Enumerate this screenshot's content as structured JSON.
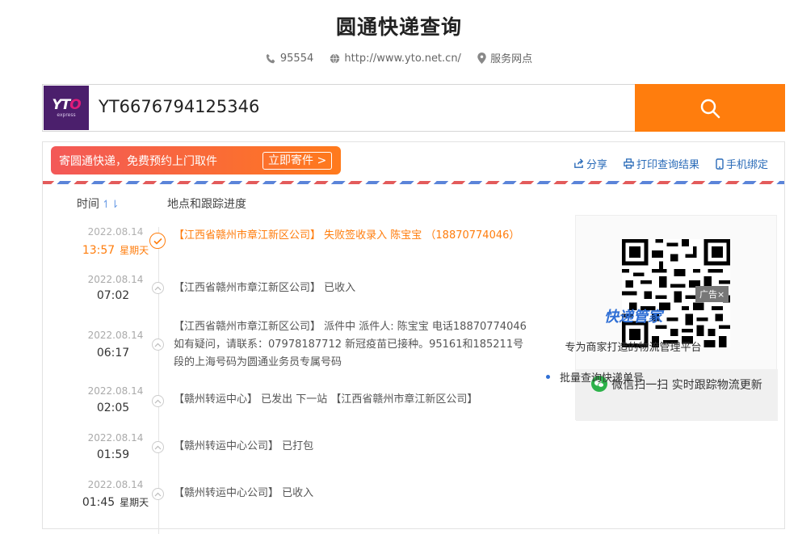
{
  "page": {
    "title": "圆通快递查询"
  },
  "info": {
    "phone": "95554",
    "website": "http://www.yto.net.cn/",
    "outlets": "服务网点"
  },
  "search": {
    "logo_text": "YTO",
    "logo_sub": "express",
    "tracking_number": "YT6676794125346",
    "icon": "search-icon"
  },
  "promo": {
    "text": "寄圆通快递，免费预约上门取件",
    "button": "立即寄件 >"
  },
  "actions": {
    "share": "分享",
    "print": "打印查询结果",
    "bind_phone": "手机绑定"
  },
  "columns": {
    "time": "时间",
    "sort_icon": "↿⇂",
    "location": "地点和跟踪进度"
  },
  "events": [
    {
      "date": "2022.08.14",
      "time": "13:57",
      "weekday": "星期天",
      "text": "【江西省赣州市章江新区公司】 失败签收录入 陈宝宝 （18870774046）"
    },
    {
      "date": "2022.08.14",
      "time": "07:02",
      "weekday": "",
      "text": "【江西省赣州市章江新区公司】 已收入"
    },
    {
      "date": "2022.08.14",
      "time": "06:17",
      "weekday": "",
      "text": "【江西省赣州市章江新区公司】 派件中 派件人: 陈宝宝 电话18870774046 如有疑问，请联系：07978187712 新冠疫苗已接种。95161和185211号段的上海号码为圆通业务员专属号码"
    },
    {
      "date": "2022.08.14",
      "time": "02:05",
      "weekday": "",
      "text": "【赣州转运中心】 已发出 下一站 【江西省赣州市章江新区公司】"
    },
    {
      "date": "2022.08.14",
      "time": "01:59",
      "weekday": "",
      "text": "【赣州转运中心公司】 已打包"
    },
    {
      "date": "2022.08.14",
      "time": "01:45",
      "weekday": "星期天",
      "text": "【赣州转运中心公司】 已收入"
    }
  ],
  "qr": {
    "caption": "微信扫一扫 实时跟踪物流更新"
  },
  "ad": {
    "tag": "广告×",
    "title": "快递管家",
    "subtitle": "专为商家打造的物流管理平台",
    "bullet": "批量查询快递单号"
  },
  "colors": {
    "accent": "#ff7d0d",
    "link": "#2a6bb8",
    "brand": "#4b1f6c"
  }
}
